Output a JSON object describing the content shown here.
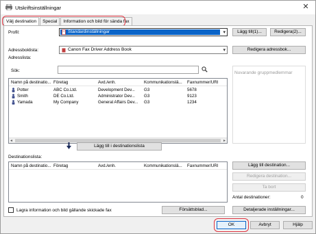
{
  "window": {
    "title": "Utskriftsinställningar",
    "close_glyph": "✕"
  },
  "tabs": [
    {
      "label": "Välj destination",
      "active": true
    },
    {
      "label": "Special",
      "active": false
    },
    {
      "label": "Information och bild för sända fax",
      "active": false
    }
  ],
  "profile": {
    "label": "Profil:",
    "value": "Standardinställningar",
    "add_button": "Lägg till(1)...",
    "edit_button": "Redigera(2)..."
  },
  "addressbook": {
    "label": "Adressboklista:",
    "value": "Canon Fax Driver Address Book",
    "edit_button": "Redigera adressbok...",
    "list_label": "Adresslista:",
    "search_label": "Sök:",
    "search_value": "",
    "columns": [
      "Namn på destinatio...",
      "Företag",
      "Avd./enh.",
      "Kommunikationslä...",
      "Faxnummer/URI"
    ],
    "rows": [
      {
        "name": "Potter",
        "company": "ABC Co.Ltd.",
        "dept": "Development Dev...",
        "comm": "G3",
        "fax": "5678"
      },
      {
        "name": "Smith",
        "company": "DE Co.Ltd.",
        "dept": "Administrator Dev...",
        "comm": "G3",
        "fax": "9123"
      },
      {
        "name": "Yamada",
        "company": "My Company",
        "dept": "General Affairs Dev...",
        "comm": "G3",
        "fax": "1234"
      }
    ],
    "group_members_label": "Nuvarande gruppmedlemmar"
  },
  "add_to_dest_button": "Lägg till i destinationslista",
  "destination": {
    "label": "Destinationslista:",
    "columns": [
      "Namn på destinatio...",
      "Företag",
      "Avd./enh.",
      "Kommunikationslä...",
      "Faxnummer/URI"
    ],
    "add_button": "Lägg till destination...",
    "edit_button": "Redigera destination...",
    "delete_button": "Ta bort",
    "count_label": "Antal destinationer:",
    "count_value": "0"
  },
  "footer": {
    "save_checkbox_label": "Lagra information och bild gällande skickade fax",
    "cover_button": "Försättsblad...",
    "details_button": "Detaljerade inställningar...",
    "ok_button": "OK",
    "cancel_button": "Avbryt",
    "help_button": "Hjälp"
  },
  "colors": {
    "highlight": "#e0333f",
    "selection": "#0a64c8"
  }
}
